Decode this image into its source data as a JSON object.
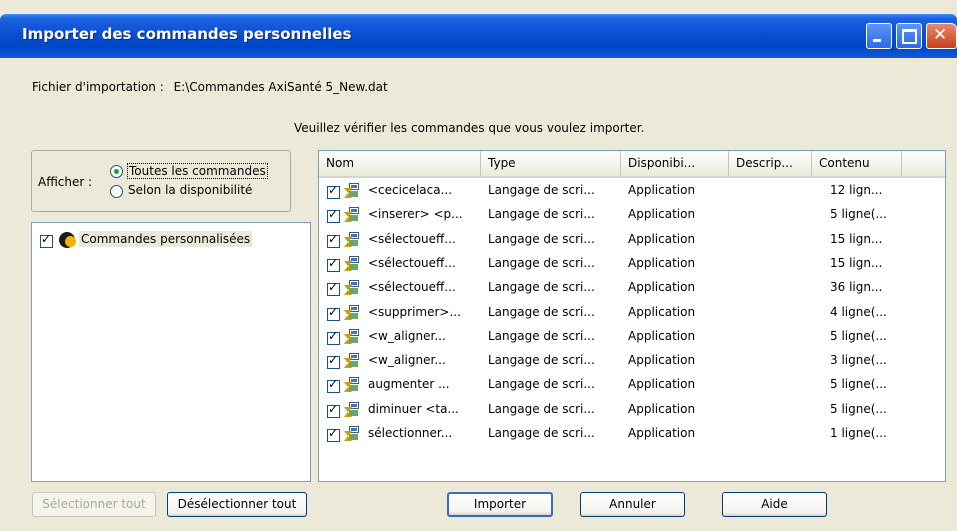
{
  "window": {
    "title": "Importer des commandes personnelles",
    "minimize_icon": "minimize-icon",
    "maximize_icon": "maximize-icon",
    "close_icon": "close-icon"
  },
  "file_label": "Fichier d'importation :",
  "file_path": "E:\\Commandes AxiSanté 5_New.dat",
  "instruction": "Veuillez vérifier les commandes que vous voulez importer.",
  "filter": {
    "label": "Afficher :",
    "options": [
      {
        "label": "Toutes les commandes",
        "selected": true
      },
      {
        "label": "Selon la disponibilité",
        "selected": false
      }
    ]
  },
  "tree": {
    "items": [
      {
        "label": "Commandes personnalisées",
        "checked": true,
        "icon": "user-folder-icon"
      }
    ]
  },
  "list": {
    "columns": [
      "Nom",
      "Type",
      "Disponibi...",
      "Descrip...",
      "Contenu"
    ],
    "rows": [
      {
        "checked": true,
        "name": "<cecicelaca...",
        "type": "Langage de scri...",
        "availability": "Application",
        "description": "",
        "content": "12 lign..."
      },
      {
        "checked": true,
        "name": "<inserer> <p...",
        "type": "Langage de scri...",
        "availability": "Application",
        "description": "",
        "content": "5 ligne(..."
      },
      {
        "checked": true,
        "name": "<sélectoueff...",
        "type": "Langage de scri...",
        "availability": "Application",
        "description": "",
        "content": "15 lign..."
      },
      {
        "checked": true,
        "name": "<sélectoueff...",
        "type": "Langage de scri...",
        "availability": "Application",
        "description": "",
        "content": "15 lign..."
      },
      {
        "checked": true,
        "name": "<sélectoueff...",
        "type": "Langage de scri...",
        "availability": "Application",
        "description": "",
        "content": "36 lign..."
      },
      {
        "checked": true,
        "name": "<supprimer>...",
        "type": "Langage de scri...",
        "availability": "Application",
        "description": "",
        "content": "4 ligne(..."
      },
      {
        "checked": true,
        "name": "<w_aligner...",
        "type": "Langage de scri...",
        "availability": "Application",
        "description": "",
        "content": "5 ligne(..."
      },
      {
        "checked": true,
        "name": "<w_aligner...",
        "type": "Langage de scri...",
        "availability": "Application",
        "description": "",
        "content": "3 ligne(..."
      },
      {
        "checked": true,
        "name": "augmenter ...",
        "type": "Langage de scri...",
        "availability": "Application",
        "description": "",
        "content": "5 ligne(..."
      },
      {
        "checked": true,
        "name": "diminuer <ta...",
        "type": "Langage de scri...",
        "availability": "Application",
        "description": "",
        "content": "5 ligne(..."
      },
      {
        "checked": true,
        "name": "sélectionner...",
        "type": "Langage de scri...",
        "availability": "Application",
        "description": "",
        "content": "1 ligne(..."
      }
    ]
  },
  "buttons": {
    "select_all": "Sélectionner tout",
    "deselect_all": "Désélectionner tout",
    "import": "Importer",
    "cancel": "Annuler",
    "help": "Aide"
  }
}
